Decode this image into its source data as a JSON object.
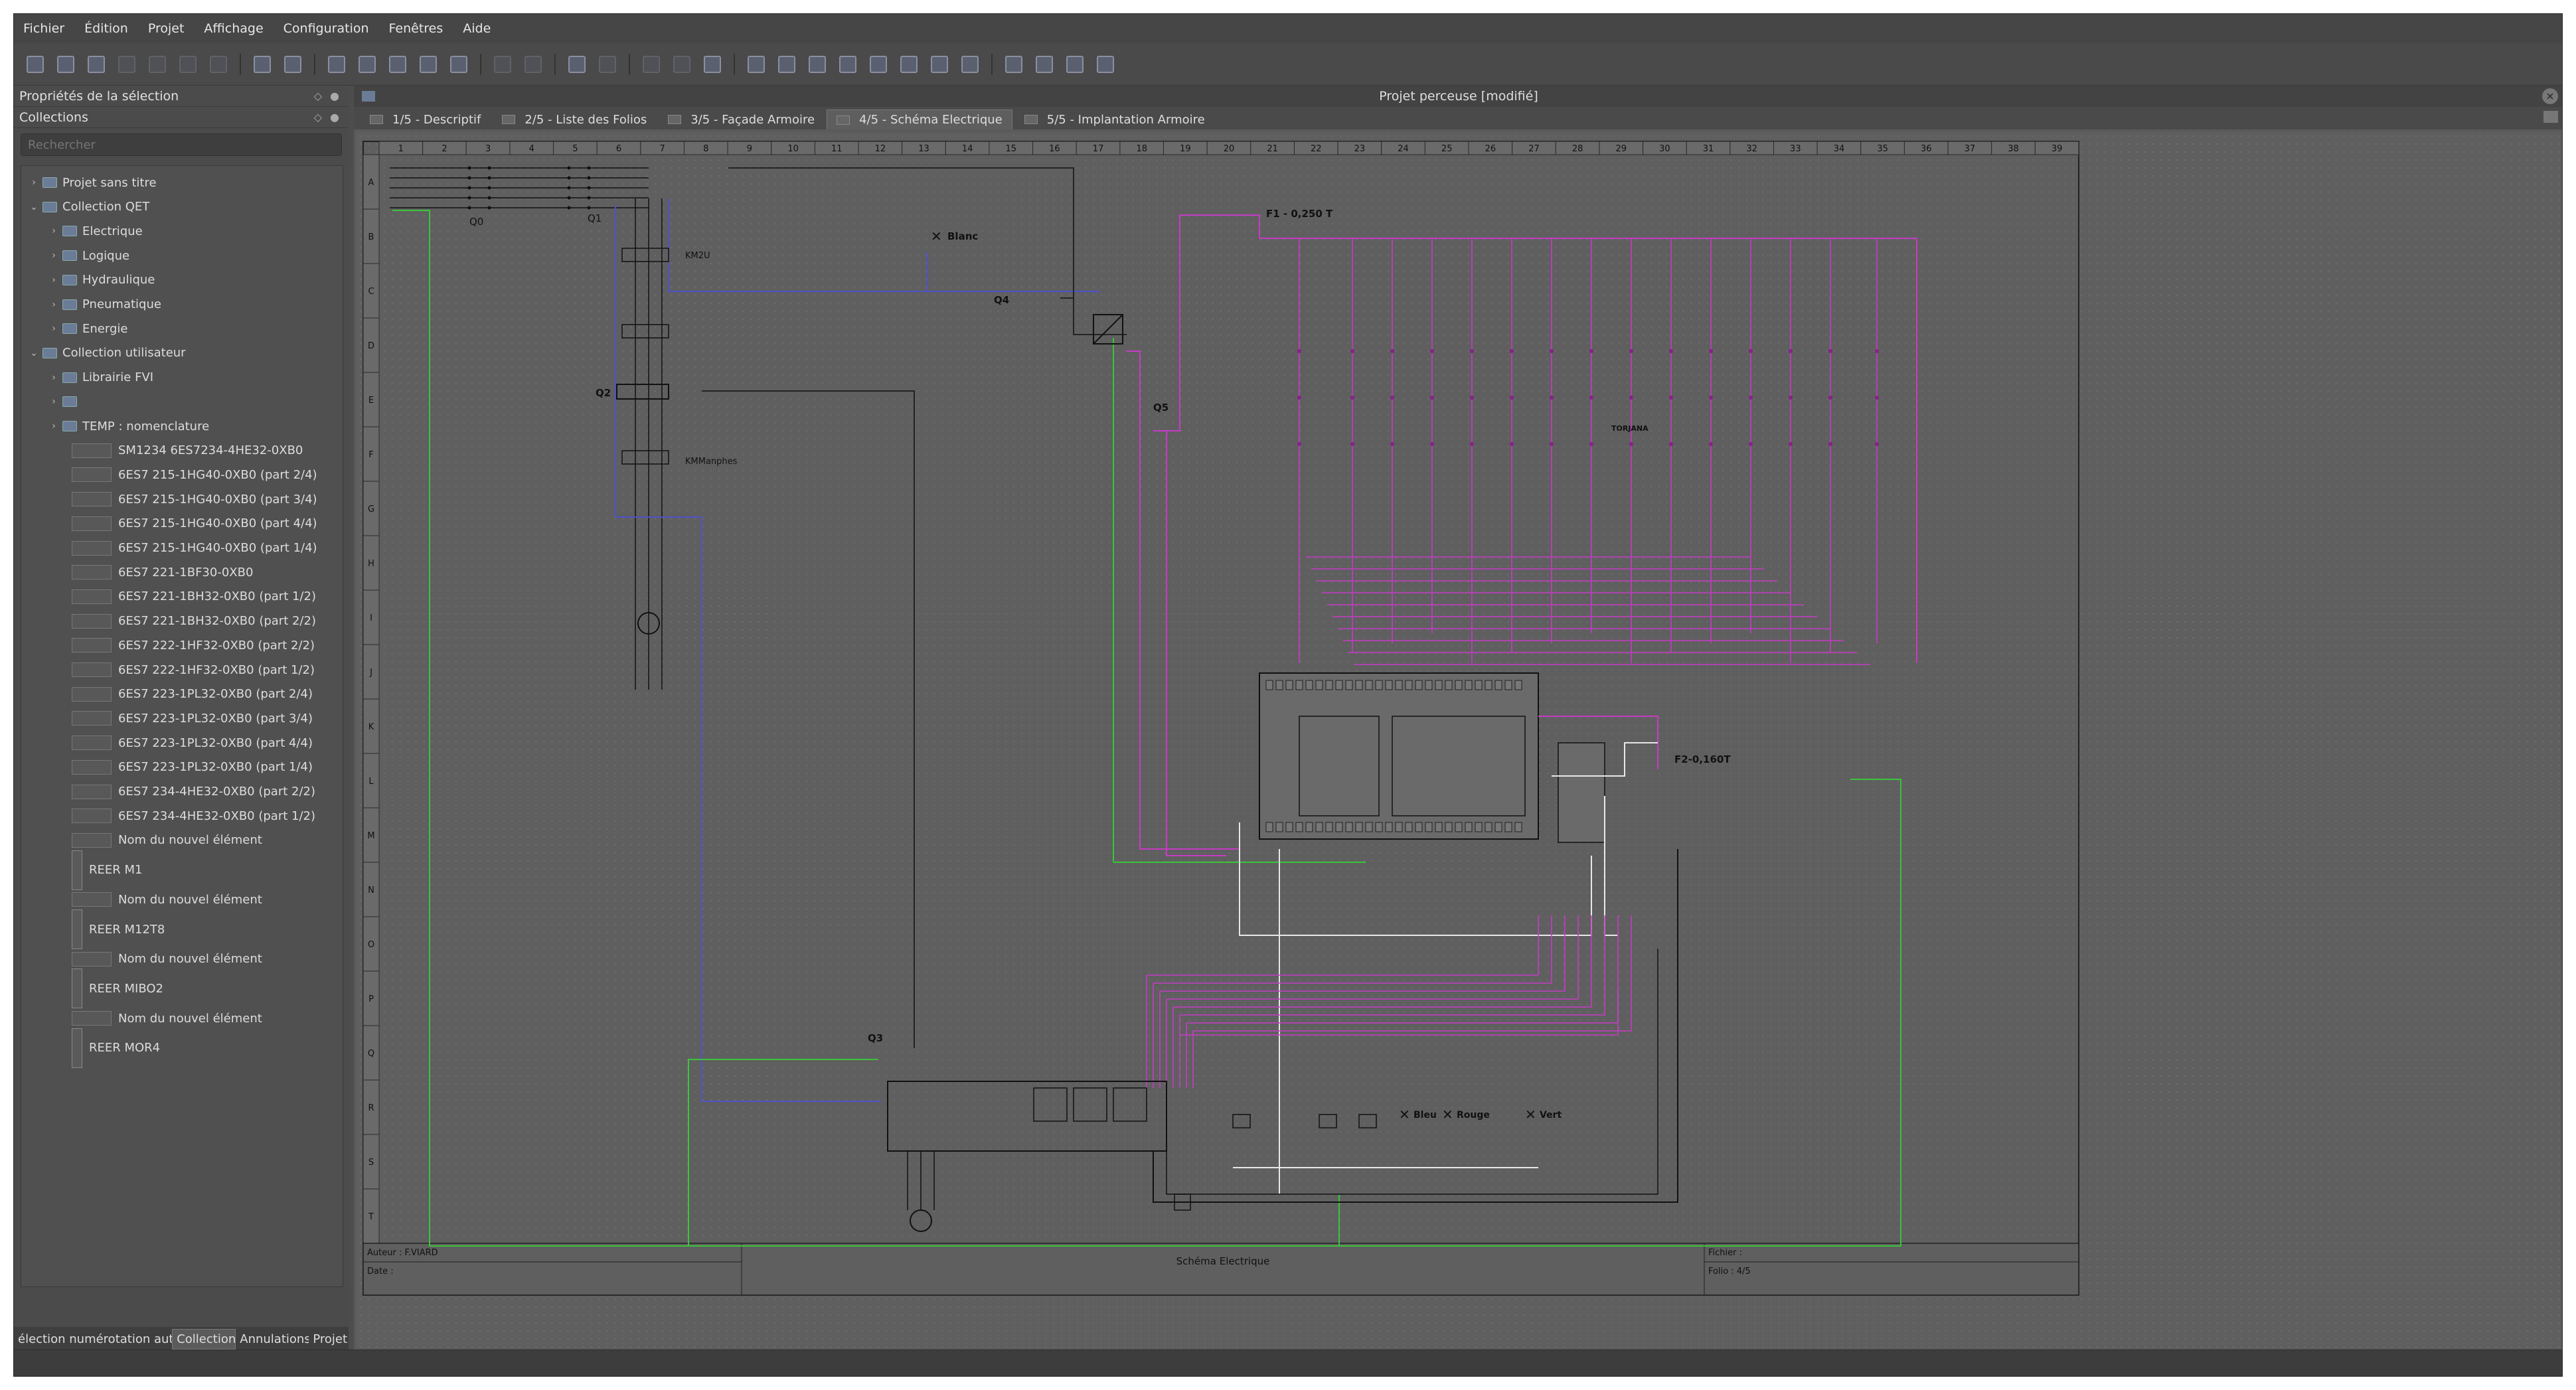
{
  "menu": [
    "Fichier",
    "Édition",
    "Projet",
    "Affichage",
    "Configuration",
    "Fenêtres",
    "Aide"
  ],
  "toolbar_icons": [
    "new-project-icon",
    "open-icon",
    "save-icon",
    "save-as-icon",
    "close-project-icon",
    "print-icon",
    "export-icon",
    "undo-icon",
    "redo-icon",
    "cut-icon",
    "copy-icon",
    "paste-icon",
    "delete-icon",
    "rotate-icon",
    "run-icon",
    "zoom-fit-icon",
    "toggle-color-icon",
    "select-icon",
    "grid-icon",
    "border-icon",
    "add-folio-icon",
    "terminal-icon",
    "table-icon",
    "text-icon",
    "image-icon",
    "line-icon",
    "rectangle-icon",
    "ellipse-icon",
    "polygon-icon",
    "bring-front-icon",
    "raise-icon",
    "lower-icon",
    "send-back-icon"
  ],
  "left": {
    "dock_title": "Propriétés de la sélection",
    "collections_title": "Collections",
    "search_placeholder": "Rechercher",
    "tree": [
      {
        "label": "Projet sans titre",
        "level": 0,
        "arrow": "›",
        "kind": "ico"
      },
      {
        "label": "Collection QET",
        "level": 0,
        "arrow": "⌄",
        "kind": "ico"
      },
      {
        "label": "Electrique",
        "level": 1,
        "arrow": "›",
        "kind": "ico"
      },
      {
        "label": "Logique",
        "level": 1,
        "arrow": "›",
        "kind": "ico"
      },
      {
        "label": "Hydraulique",
        "level": 1,
        "arrow": "›",
        "kind": "ico"
      },
      {
        "label": "Pneumatique",
        "level": 1,
        "arrow": "›",
        "kind": "ico"
      },
      {
        "label": "Energie",
        "level": 1,
        "arrow": "›",
        "kind": "ico"
      },
      {
        "label": "Collection utilisateur",
        "level": 0,
        "arrow": "⌄",
        "kind": "ico"
      },
      {
        "label": "Librairie FVI",
        "level": 1,
        "arrow": "›",
        "kind": "ico"
      },
      {
        "label": "",
        "level": 1,
        "arrow": "›",
        "kind": "ico"
      },
      {
        "label": "TEMP : nomenclature",
        "level": 1,
        "arrow": "›",
        "kind": "ico"
      },
      {
        "label": "SM1234 6ES7234-4HE32-0XB0",
        "level": 2,
        "arrow": "",
        "kind": "thumb"
      },
      {
        "label": "6ES7 215-1HG40-0XB0 (part 2/4)",
        "level": 2,
        "arrow": "",
        "kind": "thumb"
      },
      {
        "label": "6ES7 215-1HG40-0XB0 (part 3/4)",
        "level": 2,
        "arrow": "",
        "kind": "thumb"
      },
      {
        "label": "6ES7 215-1HG40-0XB0 (part 4/4)",
        "level": 2,
        "arrow": "",
        "kind": "thumb"
      },
      {
        "label": "6ES7 215-1HG40-0XB0 (part 1/4)",
        "level": 2,
        "arrow": "",
        "kind": "thumb"
      },
      {
        "label": "6ES7 221-1BF30-0XB0",
        "level": 2,
        "arrow": "",
        "kind": "thumb"
      },
      {
        "label": "6ES7 221-1BH32-0XB0 (part 1/2)",
        "level": 2,
        "arrow": "",
        "kind": "thumb"
      },
      {
        "label": "6ES7 221-1BH32-0XB0 (part 2/2)",
        "level": 2,
        "arrow": "",
        "kind": "thumb"
      },
      {
        "label": "6ES7 222-1HF32-0XB0 (part 2/2)",
        "level": 2,
        "arrow": "",
        "kind": "thumb"
      },
      {
        "label": "6ES7 222-1HF32-0XB0 (part 1/2)",
        "level": 2,
        "arrow": "",
        "kind": "thumb"
      },
      {
        "label": "6ES7 223-1PL32-0XB0 (part 2/4)",
        "level": 2,
        "arrow": "",
        "kind": "thumb"
      },
      {
        "label": "6ES7 223-1PL32-0XB0 (part 3/4)",
        "level": 2,
        "arrow": "",
        "kind": "thumb"
      },
      {
        "label": "6ES7 223-1PL32-0XB0 (part 4/4)",
        "level": 2,
        "arrow": "",
        "kind": "thumb"
      },
      {
        "label": "6ES7 223-1PL32-0XB0 (part 1/4)",
        "level": 2,
        "arrow": "",
        "kind": "thumb"
      },
      {
        "label": "6ES7 234-4HE32-0XB0 (part 2/2)",
        "level": 2,
        "arrow": "",
        "kind": "thumb"
      },
      {
        "label": "6ES7 234-4HE32-0XB0 (part 1/2)",
        "level": 2,
        "arrow": "",
        "kind": "thumb"
      },
      {
        "label": "Nom du nouvel élément",
        "level": 2,
        "arrow": "",
        "kind": "thumb"
      },
      {
        "label": "REER M1",
        "level": 2,
        "arrow": "",
        "kind": "thumbv"
      },
      {
        "label": "Nom du nouvel élément",
        "level": 2,
        "arrow": "",
        "kind": "thumb"
      },
      {
        "label": "REER M12T8",
        "level": 2,
        "arrow": "",
        "kind": "thumbv"
      },
      {
        "label": "Nom du nouvel élément",
        "level": 2,
        "arrow": "",
        "kind": "thumb"
      },
      {
        "label": "REER MIBO2",
        "level": 2,
        "arrow": "",
        "kind": "thumbv"
      },
      {
        "label": "Nom du nouvel élément",
        "level": 2,
        "arrow": "",
        "kind": "thumb"
      },
      {
        "label": "REER MOR4",
        "level": 2,
        "arrow": "",
        "kind": "thumbv"
      }
    ],
    "bottom_tabs": [
      "élection numérotation auto",
      "Collection",
      "Annulations",
      "Projet"
    ],
    "bottom_active": 1
  },
  "main": {
    "window_title": "Projet perceuse [modifié]",
    "tabs": [
      "1/5 - Descriptif",
      "2/5 - Liste des Folios",
      "3/5 - Façade Armoire",
      "4/5 - Schéma Electrique",
      "5/5 - Implantation Armoire"
    ],
    "active_tab": 3
  },
  "schematic": {
    "columns": [
      "1",
      "2",
      "3",
      "4",
      "5",
      "6",
      "7",
      "8",
      "9",
      "10",
      "11",
      "12",
      "13",
      "14",
      "15",
      "16",
      "17",
      "18",
      "19",
      "20",
      "21",
      "22",
      "23",
      "24",
      "25",
      "26",
      "27",
      "28",
      "29",
      "30",
      "31",
      "32",
      "33",
      "34",
      "35",
      "36",
      "37",
      "38",
      "39"
    ],
    "rows": [
      "A",
      "B",
      "C",
      "D",
      "E",
      "F",
      "G",
      "H",
      "I",
      "J",
      "K",
      "L",
      "M",
      "N",
      "O",
      "P",
      "Q",
      "R",
      "S",
      "T"
    ],
    "labels": {
      "blanc": "Blanc",
      "q4": "Q4",
      "q2": "Q2",
      "q5": "Q5",
      "q3": "Q3",
      "f1": "F1 - 0,250 T",
      "f2": "F2-0,160T",
      "bleu": "Bleu",
      "rouge": "Rouge",
      "vert": "Vert",
      "q0": "Q0",
      "q1": "Q1",
      "km2": "KM2U",
      "km1": "KMManphes",
      "torjana": "TORJANA"
    },
    "cartouche": {
      "author": "Auteur : F.VIARD",
      "date": "Date :",
      "title": "Schéma Electrique",
      "file": "Fichier :",
      "folio": "Folio : 4/5"
    },
    "colors": {
      "pink": "#c63bc6",
      "blue": "#4f52c8",
      "green": "#3bc43b",
      "black": "#111111",
      "white": "#e8e8e8"
    }
  }
}
